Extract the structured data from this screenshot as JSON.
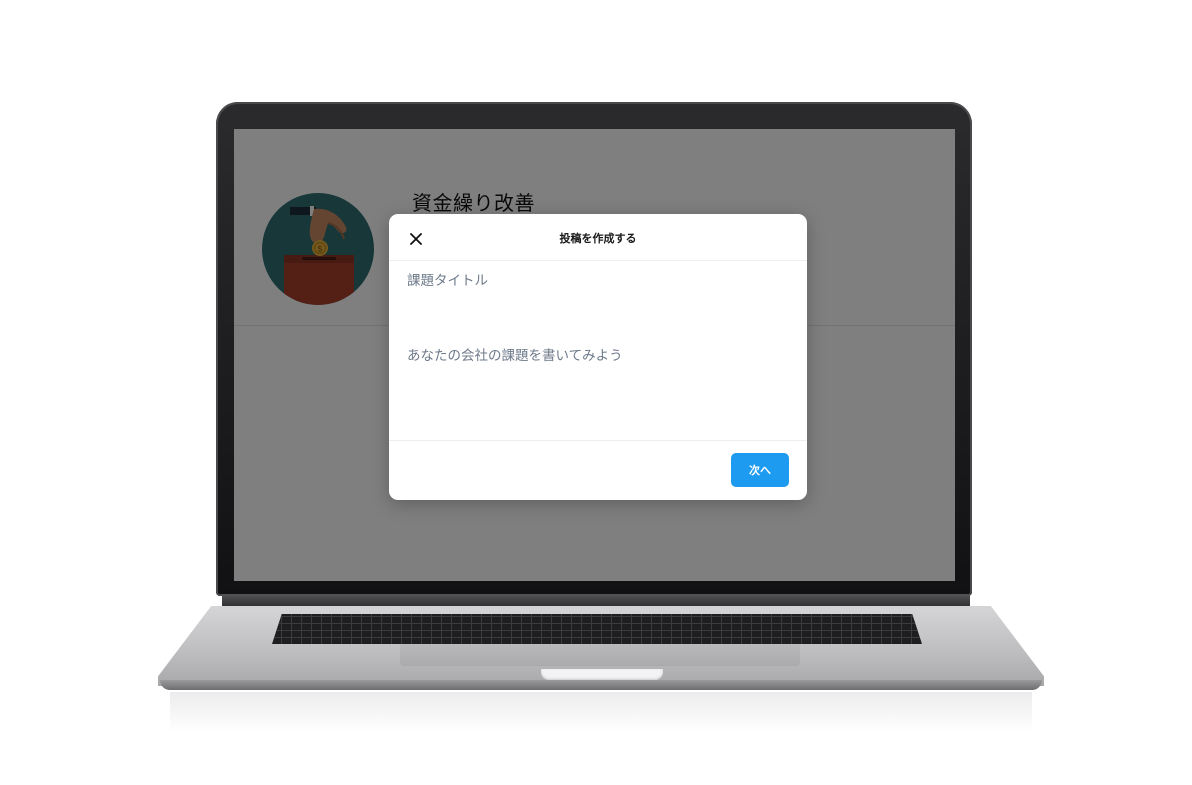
{
  "card": {
    "title": "資金繰り改善"
  },
  "modal": {
    "title": "投稿を作成する",
    "close_icon": "close-icon",
    "title_field": {
      "placeholder": "課題タイトル",
      "value": ""
    },
    "body_field": {
      "placeholder": "あなたの会社の課題を書いてみよう",
      "value": ""
    },
    "next_label": "次へ"
  },
  "colors": {
    "accent": "#1d9bf0",
    "overlay": "rgba(0,0,0,0.5)",
    "avatar_bg": "#2f6f73"
  }
}
